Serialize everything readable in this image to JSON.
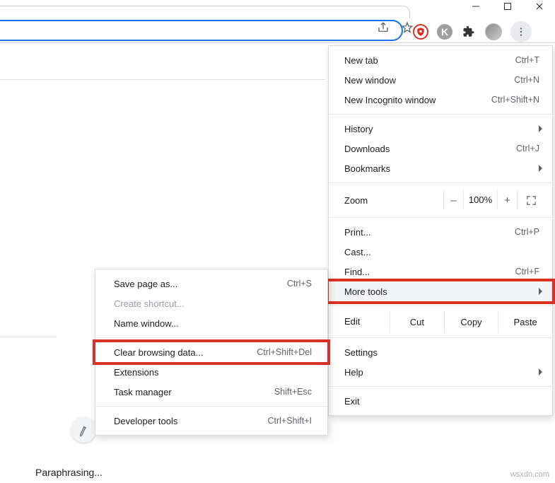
{
  "window": {
    "minimize": "–",
    "maximize": "▢",
    "close": "✕"
  },
  "toolbar": {
    "share_icon": "share-icon",
    "bookmark_icon": "star-icon",
    "ext_ublock": "uBlock",
    "ext_k": "K",
    "puzzle": "extensions-icon",
    "avatar": "profile-avatar",
    "menu": "⋮"
  },
  "menu": {
    "new_tab": {
      "label": "New tab",
      "shortcut": "Ctrl+T"
    },
    "new_window": {
      "label": "New window",
      "shortcut": "Ctrl+N"
    },
    "incognito": {
      "label": "New Incognito window",
      "shortcut": "Ctrl+Shift+N"
    },
    "history": {
      "label": "History"
    },
    "downloads": {
      "label": "Downloads",
      "shortcut": "Ctrl+J"
    },
    "bookmarks": {
      "label": "Bookmarks"
    },
    "zoom": {
      "label": "Zoom",
      "minus": "–",
      "level": "100%",
      "plus": "+"
    },
    "print": {
      "label": "Print...",
      "shortcut": "Ctrl+P"
    },
    "cast": {
      "label": "Cast..."
    },
    "find": {
      "label": "Find...",
      "shortcut": "Ctrl+F"
    },
    "more_tools": {
      "label": "More tools"
    },
    "edit": {
      "label": "Edit",
      "cut": "Cut",
      "copy": "Copy",
      "paste": "Paste"
    },
    "settings": {
      "label": "Settings"
    },
    "help": {
      "label": "Help"
    },
    "exit": {
      "label": "Exit"
    }
  },
  "submenu": {
    "save_page": {
      "label": "Save page as...",
      "shortcut": "Ctrl+S"
    },
    "create_shortcut": {
      "label": "Create shortcut..."
    },
    "name_window": {
      "label": "Name window..."
    },
    "clear_browsing": {
      "label": "Clear browsing data...",
      "shortcut": "Ctrl+Shift+Del"
    },
    "extensions": {
      "label": "Extensions"
    },
    "task_manager": {
      "label": "Task manager",
      "shortcut": "Shift+Esc"
    },
    "dev_tools": {
      "label": "Developer tools",
      "shortcut": "Ctrl+Shift+I"
    }
  },
  "status_text": "Paraphrasing...",
  "watermark": "wsxdn.com"
}
